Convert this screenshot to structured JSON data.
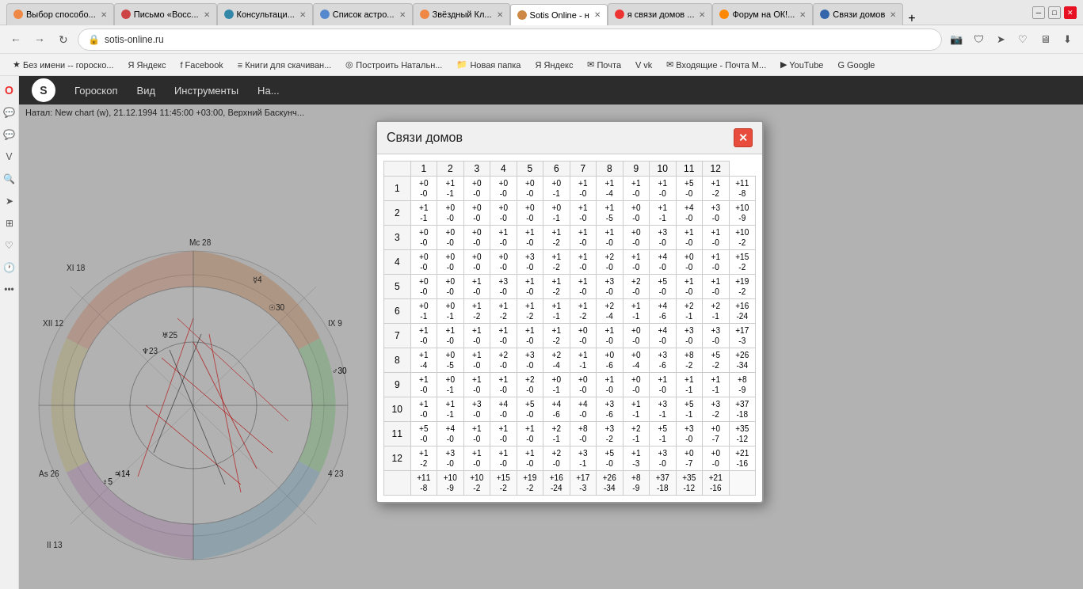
{
  "browser": {
    "tabs": [
      {
        "id": "tab1",
        "label": "Выбор способо...",
        "icon_color": "#e84",
        "active": false
      },
      {
        "id": "tab2",
        "label": "Письмо «Восс...",
        "icon_color": "#c44",
        "active": false
      },
      {
        "id": "tab3",
        "label": "Консультаци...",
        "icon_color": "#38a",
        "active": false
      },
      {
        "id": "tab4",
        "label": "Список астро...",
        "icon_color": "#58c",
        "active": false
      },
      {
        "id": "tab5",
        "label": "Звёздный Кл...",
        "icon_color": "#e84",
        "active": false
      },
      {
        "id": "tab6",
        "label": "Sotis Online - н",
        "icon_color": "#c84",
        "active": true
      },
      {
        "id": "tab7",
        "label": "я связи домов ...",
        "icon_color": "#e33",
        "active": false
      },
      {
        "id": "tab8",
        "label": "Форум на ОК!...",
        "icon_color": "#f80",
        "active": false
      },
      {
        "id": "tab9",
        "label": "Связи домов",
        "icon_color": "#36a",
        "active": false
      }
    ],
    "url": "sotis-online.ru",
    "bookmarks": [
      {
        "label": "Без имени -- гороско...",
        "icon": "★"
      },
      {
        "label": "Яндекс",
        "icon": "Я"
      },
      {
        "label": "Facebook",
        "icon": "f"
      },
      {
        "label": "Книги для скачиван...",
        "icon": "≡"
      },
      {
        "label": "Построить Натальн...",
        "icon": "◎"
      },
      {
        "label": "Новая папка",
        "icon": "📁"
      },
      {
        "label": "Яндекс",
        "icon": "Я"
      },
      {
        "label": "Почта",
        "icon": "✉"
      },
      {
        "label": "vk",
        "icon": "V"
      },
      {
        "label": "Входящие - Почта М...",
        "icon": "✉"
      },
      {
        "label": "YouTube",
        "icon": "▶"
      },
      {
        "label": "Google",
        "icon": "G"
      }
    ]
  },
  "sotis": {
    "menu_items": [
      "Гороскоп",
      "Вид",
      "Инструменты",
      "На..."
    ],
    "natal_label": "Натал: New chart (w), 21.12.1994 11:45:00 +03:00, Верхний Баскунч..."
  },
  "modal": {
    "title": "Связи домов",
    "close_label": "✕",
    "col_headers": [
      "",
      "1",
      "2",
      "3",
      "4",
      "5",
      "6",
      "7",
      "8",
      "9",
      "10",
      "11",
      "12"
    ],
    "rows": [
      {
        "row_header": "1",
        "cells": [
          [
            "+0",
            "-0"
          ],
          [
            "+1",
            "-1"
          ],
          [
            "+0",
            "-0"
          ],
          [
            "+0",
            "-0"
          ],
          [
            "+0",
            "-0"
          ],
          [
            "+0",
            "-1"
          ],
          [
            "+1",
            "-0"
          ],
          [
            "+1",
            "-4"
          ],
          [
            "+1",
            "-0"
          ],
          [
            "+1",
            "-0"
          ],
          [
            "+5",
            "-0"
          ],
          [
            "+1",
            "-2"
          ],
          [
            "+11",
            "-8"
          ]
        ]
      },
      {
        "row_header": "2",
        "cells": [
          [
            "+1",
            "-1"
          ],
          [
            "+0",
            "-0"
          ],
          [
            "+0",
            "-0"
          ],
          [
            "+0",
            "-0"
          ],
          [
            "+0",
            "-0"
          ],
          [
            "+0",
            "-1"
          ],
          [
            "+1",
            "-0"
          ],
          [
            "+1",
            "-5"
          ],
          [
            "+0",
            "-0"
          ],
          [
            "+1",
            "-1"
          ],
          [
            "+4",
            "-0"
          ],
          [
            "+3",
            "-0"
          ],
          [
            "+10",
            "-9"
          ]
        ]
      },
      {
        "row_header": "3",
        "cells": [
          [
            "+0",
            "-0"
          ],
          [
            "+0",
            "-0"
          ],
          [
            "+0",
            "-0"
          ],
          [
            "+1",
            "-0"
          ],
          [
            "+1",
            "-0"
          ],
          [
            "+1",
            "-2"
          ],
          [
            "+1",
            "-0"
          ],
          [
            "+1",
            "-0"
          ],
          [
            "+0",
            "-0"
          ],
          [
            "+3",
            "-0"
          ],
          [
            "+1",
            "-0"
          ],
          [
            "+1",
            "-0"
          ],
          [
            "+10",
            "-2"
          ]
        ]
      },
      {
        "row_header": "4",
        "cells": [
          [
            "+0",
            "-0"
          ],
          [
            "+0",
            "-0"
          ],
          [
            "+0",
            "-0"
          ],
          [
            "+0",
            "-0"
          ],
          [
            "+3",
            "-0"
          ],
          [
            "+1",
            "-2"
          ],
          [
            "+1",
            "-0"
          ],
          [
            "+2",
            "-0"
          ],
          [
            "+1",
            "-0"
          ],
          [
            "+4",
            "-0"
          ],
          [
            "+0",
            "-0"
          ],
          [
            "+1",
            "-0"
          ],
          [
            "+15",
            "-2"
          ]
        ]
      },
      {
        "row_header": "5",
        "cells": [
          [
            "+0",
            "-0"
          ],
          [
            "+0",
            "-0"
          ],
          [
            "+1",
            "-0"
          ],
          [
            "+3",
            "-0"
          ],
          [
            "+1",
            "-0"
          ],
          [
            "+1",
            "-2"
          ],
          [
            "+1",
            "-0"
          ],
          [
            "+3",
            "-0"
          ],
          [
            "+2",
            "-0"
          ],
          [
            "+5",
            "-0"
          ],
          [
            "+1",
            "-0"
          ],
          [
            "+1",
            "-0"
          ],
          [
            "+19",
            "-2"
          ]
        ]
      },
      {
        "row_header": "6",
        "cells": [
          [
            "+0",
            "-1"
          ],
          [
            "+0",
            "-1"
          ],
          [
            "+1",
            "-2"
          ],
          [
            "+1",
            "-2"
          ],
          [
            "+1",
            "-2"
          ],
          [
            "+1",
            "-1"
          ],
          [
            "+1",
            "-2"
          ],
          [
            "+2",
            "-4"
          ],
          [
            "+1",
            "-1"
          ],
          [
            "+4",
            "-6"
          ],
          [
            "+2",
            "-1"
          ],
          [
            "+2",
            "-1"
          ],
          [
            "+16",
            "-24"
          ]
        ]
      },
      {
        "row_header": "7",
        "cells": [
          [
            "+1",
            "-0"
          ],
          [
            "+1",
            "-0"
          ],
          [
            "+1",
            "-0"
          ],
          [
            "+1",
            "-0"
          ],
          [
            "+1",
            "-0"
          ],
          [
            "+1",
            "-2"
          ],
          [
            "+0",
            "-0"
          ],
          [
            "+1",
            "-0"
          ],
          [
            "+0",
            "-0"
          ],
          [
            "+4",
            "-0"
          ],
          [
            "+3",
            "-0"
          ],
          [
            "+3",
            "-0"
          ],
          [
            "+17",
            "-3"
          ]
        ]
      },
      {
        "row_header": "8",
        "cells": [
          [
            "+1",
            "-4"
          ],
          [
            "+0",
            "-5"
          ],
          [
            "+1",
            "-0"
          ],
          [
            "+2",
            "-0"
          ],
          [
            "+3",
            "-0"
          ],
          [
            "+2",
            "-4"
          ],
          [
            "+1",
            "-1"
          ],
          [
            "+0",
            "-6"
          ],
          [
            "+0",
            "-4"
          ],
          [
            "+3",
            "-6"
          ],
          [
            "+8",
            "-2"
          ],
          [
            "+5",
            "-2"
          ],
          [
            "+26",
            "-34"
          ]
        ]
      },
      {
        "row_header": "9",
        "cells": [
          [
            "+1",
            "-0"
          ],
          [
            "+0",
            "-1"
          ],
          [
            "+1",
            "-0"
          ],
          [
            "+1",
            "-0"
          ],
          [
            "+2",
            "-0"
          ],
          [
            "+0",
            "-1"
          ],
          [
            "+0",
            "-0"
          ],
          [
            "+1",
            "-0"
          ],
          [
            "+0",
            "-0"
          ],
          [
            "+1",
            "-0"
          ],
          [
            "+1",
            "-1"
          ],
          [
            "+1",
            "-1"
          ],
          [
            "+8",
            "-9"
          ]
        ]
      },
      {
        "row_header": "10",
        "cells": [
          [
            "+1",
            "-0"
          ],
          [
            "+1",
            "-1"
          ],
          [
            "+3",
            "-0"
          ],
          [
            "+4",
            "-0"
          ],
          [
            "+5",
            "-0"
          ],
          [
            "+4",
            "-6"
          ],
          [
            "+4",
            "-0"
          ],
          [
            "+3",
            "-6"
          ],
          [
            "+1",
            "-1"
          ],
          [
            "+3",
            "-1"
          ],
          [
            "+5",
            "-1"
          ],
          [
            "+3",
            "-2"
          ],
          [
            "+37",
            "-18"
          ]
        ]
      },
      {
        "row_header": "11",
        "cells": [
          [
            "+5",
            "-0"
          ],
          [
            "+4",
            "-0"
          ],
          [
            "+1",
            "-0"
          ],
          [
            "+1",
            "-0"
          ],
          [
            "+1",
            "-0"
          ],
          [
            "+2",
            "-1"
          ],
          [
            "+8",
            "-0"
          ],
          [
            "+3",
            "-2"
          ],
          [
            "+2",
            "-1"
          ],
          [
            "+5",
            "-1"
          ],
          [
            "+3",
            "-0"
          ],
          [
            "+0",
            "-7"
          ],
          [
            "+35",
            "-12"
          ]
        ]
      },
      {
        "row_header": "12",
        "cells": [
          [
            "+1",
            "-2"
          ],
          [
            "+3",
            "-0"
          ],
          [
            "+1",
            "-0"
          ],
          [
            "+1",
            "-0"
          ],
          [
            "+1",
            "-0"
          ],
          [
            "+2",
            "-0"
          ],
          [
            "+3",
            "-1"
          ],
          [
            "+5",
            "-0"
          ],
          [
            "+1",
            "-3"
          ],
          [
            "+3",
            "-0"
          ],
          [
            "+0",
            "-7"
          ],
          [
            "+0",
            "-0"
          ],
          [
            "+21",
            "-16"
          ]
        ]
      },
      {
        "row_header": "",
        "cells": [
          [
            "+11",
            "-8"
          ],
          [
            "+10",
            "-9"
          ],
          [
            "+10",
            "-2"
          ],
          [
            "+15",
            "-2"
          ],
          [
            "+19",
            "-2"
          ],
          [
            "+16",
            "-24"
          ],
          [
            "+17",
            "-3"
          ],
          [
            "+26",
            "-34"
          ],
          [
            "+8",
            "-9"
          ],
          [
            "+37",
            "-18"
          ],
          [
            "+35",
            "-12"
          ],
          [
            "+21",
            "-16"
          ],
          [
            "",
            ""
          ]
        ]
      }
    ]
  }
}
